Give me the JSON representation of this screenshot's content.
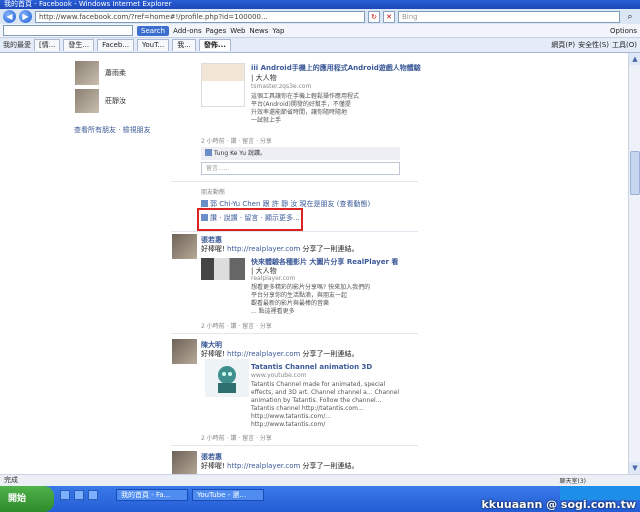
{
  "title_bar": {
    "text": "我的首頁 - Facebook - Windows Internet Explorer"
  },
  "address_bar": {
    "url": "http://www.facebook.com/?ref=home#!/profile.php?id=100000...",
    "search_placeholder": "Bing"
  },
  "toolbar": {
    "search_label": "Search",
    "items": [
      "Add-ons",
      "Pages",
      "Web",
      "News",
      "Yap"
    ],
    "options_label": "Options"
  },
  "tabs": [
    "我的最愛",
    "[情...",
    "發生...",
    "Faceb...",
    "YouT...",
    "我...",
    "發佈..."
  ],
  "command_bar": {
    "items": [
      "網頁(P)",
      "安全性(S)",
      "工具(O)"
    ]
  },
  "sidebar": {
    "people": [
      {
        "name": "蕭雨柔"
      },
      {
        "name": "莊靜汝"
      }
    ],
    "link": "查看所有朋友 · 檢視朋友"
  },
  "feed": {
    "post1": {
      "attachment_title": "iii Android手機上的應用程式Android遊戲人物體驗",
      "attachment_source": "| 大人物",
      "attachment_site": "tsmaster.zqs3e.com",
      "attachment_desc": [
        "這個工具讓你在手機上輕鬆操作應用程式",
        "平台(Android)開發的好幫手，不僅提",
        "升效率還能節省時間，讓你隨時隨地",
        "一試就上手"
      ],
      "meta": "2 小時前 · 讚 · 留言 · 分享",
      "like_line": "Tung Ke Yu 說讚。",
      "comment_placeholder": "留言......"
    },
    "post2": {
      "small_title": "朋友動態",
      "text": "郭 Chi-Yu Chen 跟 許 靜 汝 現在是朋友",
      "text_suffix": "(查看動態)",
      "actions": "讚 · 說讚 · 留言 · 顯示更多..."
    },
    "post3": {
      "name": "張若惠",
      "text": "好棒喔!",
      "link": "http://realplayer.com",
      "text_after": "分享了一則連結。",
      "attachment_title": "快來體驗各種影片 大圖片分享 RealPlayer 看",
      "attachment_source": "| 大人物",
      "attachment_site": "realplayer.com",
      "attachment_desc": [
        "想看更多精彩的影片分享嗎? 快來加入我們的",
        "平台分享你的生活點滴，與朋友一起",
        "觀看最新的影片與最棒的音樂",
        "... 點這裡看更多"
      ],
      "meta": "2 小時前 · 讚 · 留言 · 分享"
    },
    "post4": {
      "name": "陳大明",
      "text": "好棒喔!",
      "link": "http://realplayer.com",
      "text_after": "分享了一則連結。",
      "attachment_title": "Tatantis Channel animation 3D",
      "attachment_site": "www.youtube.com",
      "attachment_desc": [
        "Tatantis Channel made for animated, special",
        "effects, and 3D art. Channel channel a... Channel",
        "animation by Tatantis. Follow the channel...",
        "Tatantis channel http://tatantis.com...",
        "http://www.tatantis.com/...",
        "http://www.tatantis.com/"
      ],
      "meta": "2 小時前 · 讚 · 留言 · 分享"
    },
    "post5": {
      "name": "張若惠",
      "text": "好棒喔!",
      "link": "http://realplayer.com",
      "text_after": "分享了一則連結。"
    }
  },
  "status_bar": {
    "text": "完成",
    "chat": "聊天室(3)"
  },
  "taskbar": {
    "start": "開始",
    "tasks": [
      "我的首頁 - Fa...",
      "YouTube - 瀏..."
    ]
  },
  "watermark": "kkuuaann @ sogi.com.tw"
}
